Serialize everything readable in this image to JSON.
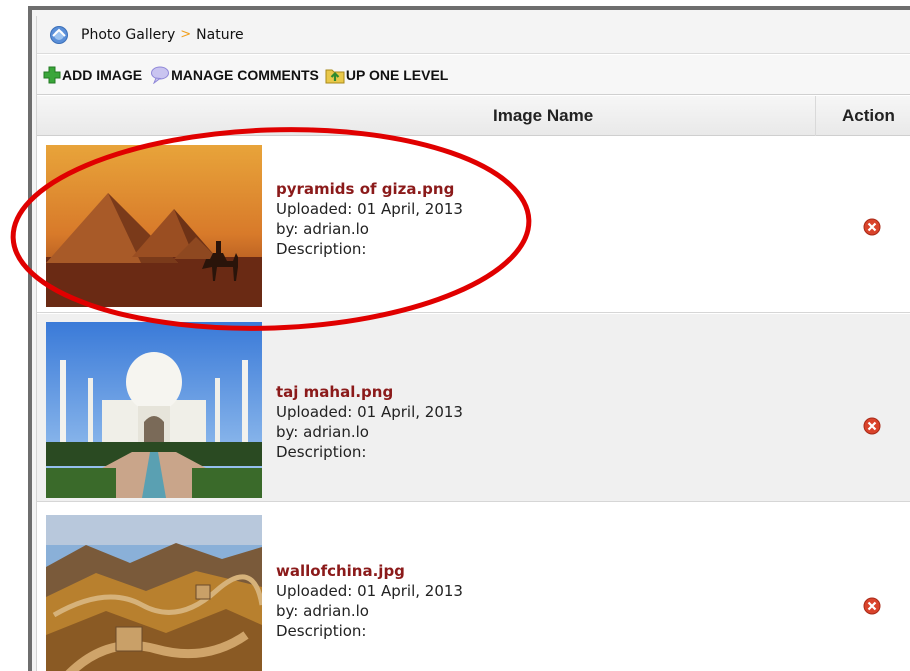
{
  "breadcrumb": {
    "root": "Photo Gallery",
    "separator": ">",
    "current": "Nature"
  },
  "toolbar": {
    "add_image": "ADD IMAGE",
    "manage_comments": "MANAGE COMMENTS",
    "up_one_level": "UP ONE LEVEL"
  },
  "table": {
    "col_name": "Image Name",
    "col_action": "Action"
  },
  "rows": [
    {
      "filename": "pyramids of giza.png",
      "uploaded": "Uploaded: 01 April, 2013",
      "by": "by: adrian.lo",
      "description": "Description:"
    },
    {
      "filename": "taj mahal.png",
      "uploaded": "Uploaded: 01 April, 2013",
      "by": "by: adrian.lo",
      "description": "Description:"
    },
    {
      "filename": "wallofchina.jpg",
      "uploaded": "Uploaded: 01 April, 2013",
      "by": "by: adrian.lo",
      "description": "Description:"
    }
  ],
  "colors": {
    "filename": "#8b1a1a",
    "highlight_ellipse": "#e00000",
    "delete_icon": "#d9432b"
  },
  "icons": [
    "home-icon",
    "add-icon",
    "comments-icon",
    "folder-up-icon",
    "delete-icon"
  ]
}
